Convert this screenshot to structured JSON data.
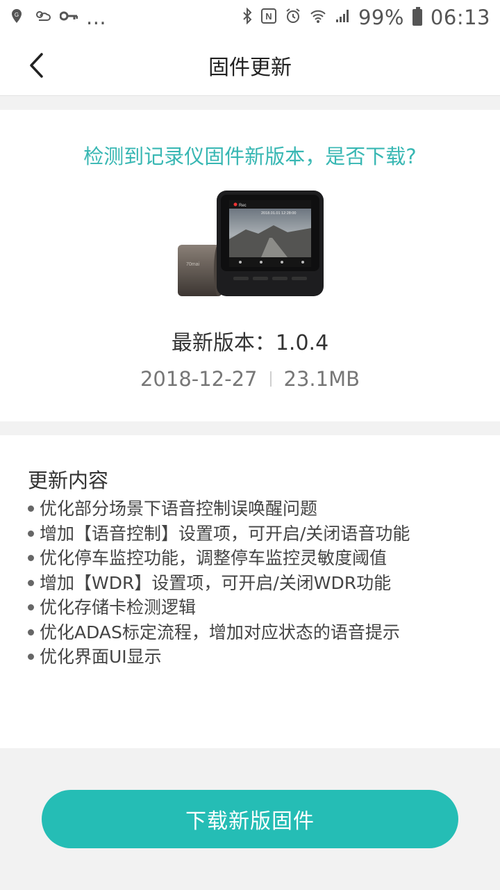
{
  "status_bar": {
    "left_icons": [
      "location-g-icon",
      "weather-icon",
      "vpn-key-icon",
      "more-dots-icon"
    ],
    "more_text": "...",
    "right_icons": [
      "bluetooth-icon",
      "nfc-icon",
      "alarm-icon",
      "wifi-icon",
      "signal-icon"
    ],
    "battery": "99%",
    "time": "06:13"
  },
  "header": {
    "title": "固件更新",
    "back_icon": "chevron-left-icon"
  },
  "update": {
    "prompt": "检测到记录仪固件新版本，是否下载?",
    "version_label": "最新版本：1.0.4",
    "date": "2018-12-27",
    "size": "23.1MB",
    "device_screen_rec": "Rec",
    "device_screen_datetime": "2018.01.01  12:28:00",
    "device_brand": "70mai"
  },
  "notes": {
    "title": "更新内容",
    "items": [
      "优化部分场景下语音控制误唤醒问题",
      "增加【语音控制】设置项，可开启/关闭语音功能",
      "优化停车监控功能，调整停车监控灵敏度阈值",
      "增加【WDR】设置项，可开启/关闭WDR功能",
      "优化存储卡检测逻辑",
      "优化ADAS标定流程，增加对应状态的语音提示",
      "优化界面UI显示"
    ]
  },
  "actions": {
    "download_label": "下载新版固件"
  },
  "colors": {
    "accent": "#25bdb5",
    "prompt_text": "#38b7b3"
  }
}
